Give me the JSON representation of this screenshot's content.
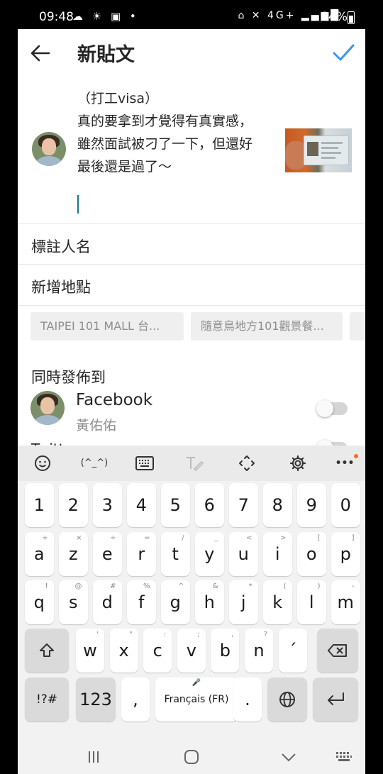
{
  "status_bar": {
    "time": "09:48",
    "left_icons": "☁ ☀ ▣ •",
    "right_icons": "⌂ ✕ 4G+ ▂▄▆█",
    "battery": "84%"
  },
  "header": {
    "title": "新貼文"
  },
  "post": {
    "caption": "（打工visa）\n真的要拿到才覺得有真實感，\n雖然面試被刁了一下，但還好\n最後還是過了～"
  },
  "options": {
    "tag_people": "標註人名",
    "add_location": "新增地點",
    "location_suggestions": [
      "TAIPEI 101 MALL 台...",
      "隨意鳥地方101觀景餐..."
    ]
  },
  "share_to": {
    "label": "同時發佈到",
    "facebook": {
      "name": "Facebook",
      "account": "黃佑佑",
      "enabled": false
    },
    "twitter": {
      "name": "Twitter",
      "enabled": false
    }
  },
  "keyboard": {
    "toolbar": [
      "emoji-icon",
      "(^_^)",
      "keyboard-icon",
      "handwriting-icon",
      "cursor-move-icon",
      "gear-icon",
      "more-icon"
    ],
    "emoticon_label": "(^_^)",
    "more_label": "•••",
    "rows": [
      [
        {
          "k": "1"
        },
        {
          "k": "2"
        },
        {
          "k": "3"
        },
        {
          "k": "4"
        },
        {
          "k": "5"
        },
        {
          "k": "6"
        },
        {
          "k": "7"
        },
        {
          "k": "8"
        },
        {
          "k": "9"
        },
        {
          "k": "0"
        }
      ],
      [
        {
          "k": "a",
          "s": "+"
        },
        {
          "k": "z",
          "s": "×"
        },
        {
          "k": "e",
          "s": "÷"
        },
        {
          "k": "r",
          "s": "="
        },
        {
          "k": "t",
          "s": "/"
        },
        {
          "k": "y",
          "s": "_"
        },
        {
          "k": "u",
          "s": "<"
        },
        {
          "k": "i",
          "s": ">"
        },
        {
          "k": "o",
          "s": "["
        },
        {
          "k": "p",
          "s": "]"
        }
      ],
      [
        {
          "k": "q",
          "s": "!"
        },
        {
          "k": "s",
          "s": "@"
        },
        {
          "k": "d",
          "s": "#"
        },
        {
          "k": "f",
          "s": "%"
        },
        {
          "k": "g",
          "s": "^"
        },
        {
          "k": "h",
          "s": "&"
        },
        {
          "k": "j",
          "s": "*"
        },
        {
          "k": "k",
          "s": "("
        },
        {
          "k": "l",
          "s": ")"
        },
        {
          "k": "m",
          "s": "-"
        }
      ],
      [
        {
          "k": "w",
          "s": "'"
        },
        {
          "k": "x",
          "s": "\""
        },
        {
          "k": "c",
          "s": ":"
        },
        {
          "k": "v",
          "s": ";"
        },
        {
          "k": "b",
          "s": ","
        },
        {
          "k": "n",
          "s": "?"
        },
        {
          "k": "´"
        }
      ]
    ],
    "symbols_key": "!?#",
    "numbers_key": "123",
    "comma_key": ",",
    "space_label": "Français (FR)",
    "period_key": ".",
    "nav": {
      "recents": "|||",
      "home": "○",
      "back": "∨"
    }
  },
  "colors": {
    "accent": "#3897f0",
    "cursor": "#0f7a86",
    "badge": "#f37021"
  }
}
